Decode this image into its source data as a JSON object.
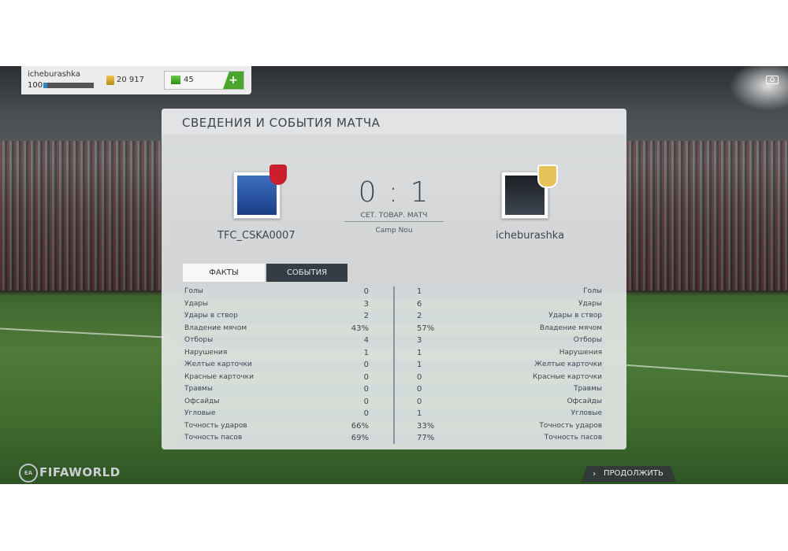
{
  "hud": {
    "username": "icheburashka",
    "level": "100",
    "xp_progress": 0.08,
    "coins": "20 917",
    "cash": "45",
    "add_label": "+"
  },
  "panel": {
    "title": "СВЕДЕНИЯ И СОБЫТИЯ МАТЧА",
    "home_team": "TFC_CSKA0007",
    "away_team": "icheburashka",
    "score": "0 : 1",
    "match_type": "СЕТ. ТОВАР. МАТЧ",
    "venue": "Camp Nou",
    "home_badge_color": "#cc1f2d",
    "away_badge_color": "#e8c35a"
  },
  "tabs": {
    "facts": "ФАКТЫ",
    "events": "СОБЫТИЯ"
  },
  "stats": [
    {
      "label": "Голы",
      "home": "0",
      "away": "1"
    },
    {
      "label": "Удары",
      "home": "3",
      "away": "6"
    },
    {
      "label": "Удары в створ",
      "home": "2",
      "away": "2"
    },
    {
      "label": "Владение мячом",
      "home": "43%",
      "away": "57%"
    },
    {
      "label": "Отборы",
      "home": "4",
      "away": "3"
    },
    {
      "label": "Нарушения",
      "home": "1",
      "away": "1"
    },
    {
      "label": "Желтые карточки",
      "home": "0",
      "away": "1"
    },
    {
      "label": "Красные карточки",
      "home": "0",
      "away": "0"
    },
    {
      "label": "Травмы",
      "home": "0",
      "away": "0"
    },
    {
      "label": "Офсайды",
      "home": "0",
      "away": "0"
    },
    {
      "label": "Угловые",
      "home": "0",
      "away": "1"
    },
    {
      "label": "Точность ударов",
      "home": "66%",
      "away": "33%"
    },
    {
      "label": "Точность пасов",
      "home": "69%",
      "away": "77%"
    }
  ],
  "footer": {
    "logo_text": "FIFAWORLD",
    "logo_ea": "EA",
    "continue_label": "ПРОДОЛЖИТЬ"
  }
}
